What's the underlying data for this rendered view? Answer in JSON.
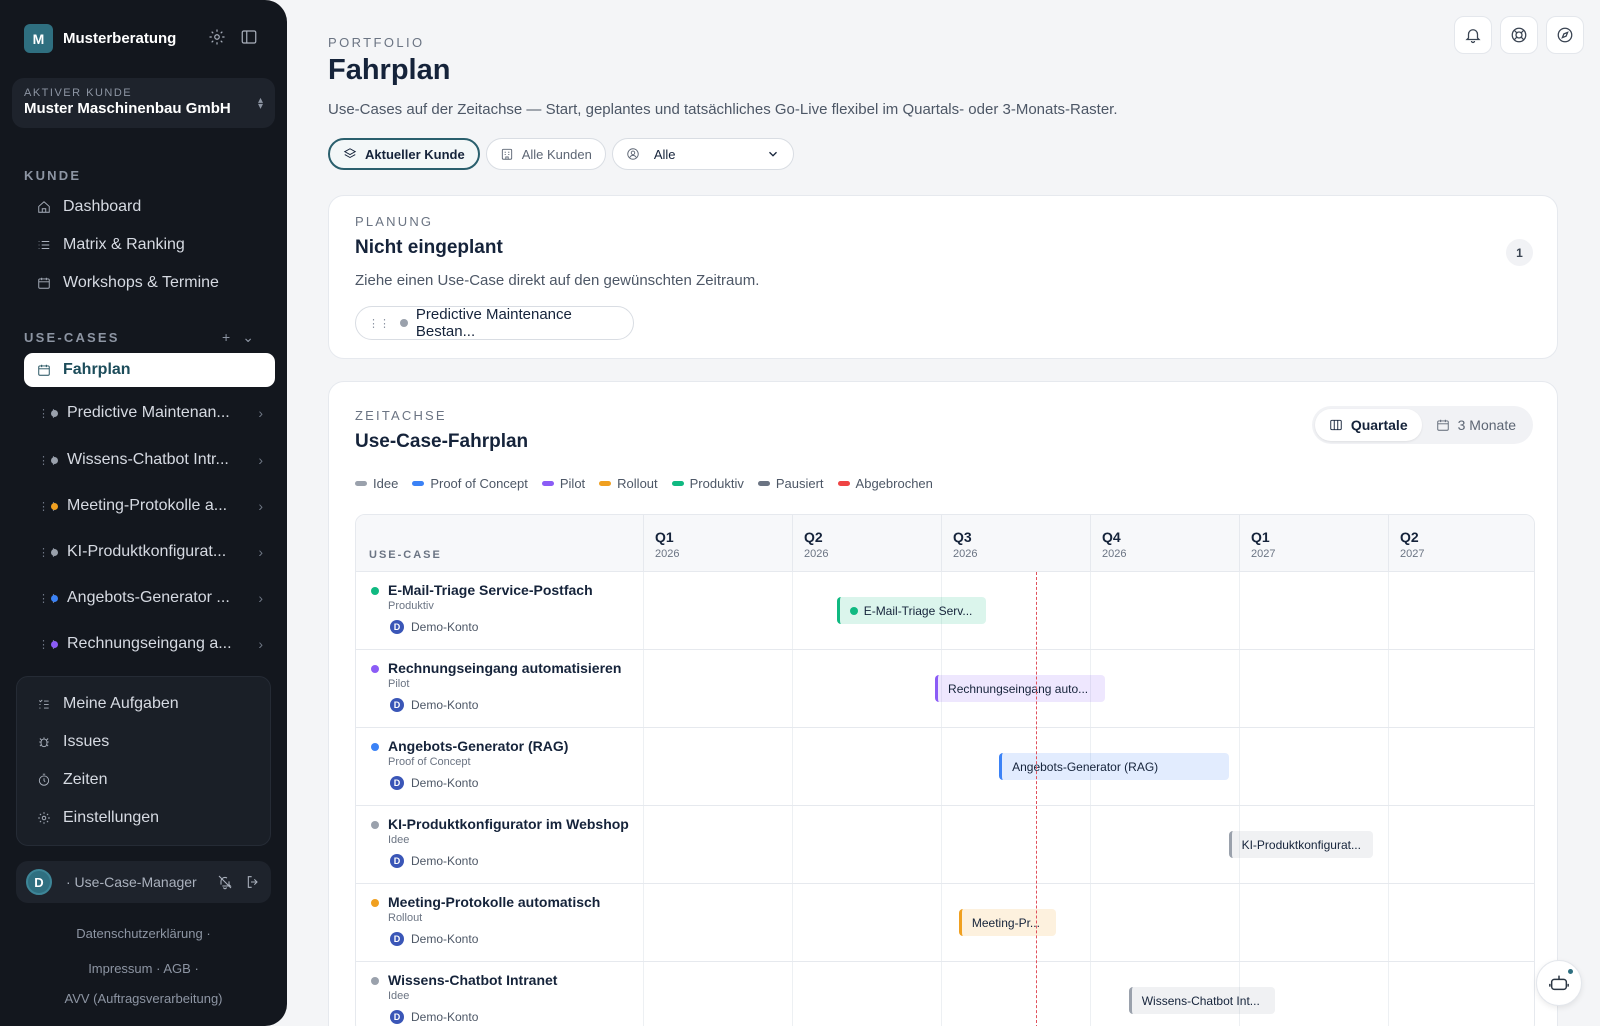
{
  "sidebar": {
    "brand_initial": "M",
    "brand_name": "Musterberatung",
    "client_label": "AKTIVER KUNDE",
    "client_name": "Muster Maschinenbau GmbH",
    "section_kunde": "KUNDE",
    "kunde_items": [
      {
        "label": "Dashboard",
        "icon": "home-icon"
      },
      {
        "label": "Matrix & Ranking",
        "icon": "list-icon"
      },
      {
        "label": "Workshops & Termine",
        "icon": "calendar-icon"
      }
    ],
    "section_usecases": "USE-CASES",
    "active_item": "Fahrplan",
    "usecase_items": [
      {
        "label": "Predictive Maintenan...",
        "color": "#9aa1ac"
      },
      {
        "label": "Wissens-Chatbot Intr...",
        "color": "#9aa1ac"
      },
      {
        "label": "Meeting-Protokolle a...",
        "color": "#f0a020"
      },
      {
        "label": "KI-Produktkonfigurat...",
        "color": "#9aa1ac"
      },
      {
        "label": "Angebots-Generator ...",
        "color": "#3b82f6"
      },
      {
        "label": "Rechnungseingang a...",
        "color": "#8b5cf6"
      }
    ],
    "tools": [
      {
        "label": "Meine Aufgaben",
        "icon": "tasks-icon"
      },
      {
        "label": "Issues",
        "icon": "bug-icon"
      },
      {
        "label": "Zeiten",
        "icon": "timer-icon"
      },
      {
        "label": "Einstellungen",
        "icon": "gear-icon"
      }
    ],
    "user_initial": "D",
    "user_role": "· Use-Case-Manager",
    "footer": {
      "privacy": "Datenschutzerklärung",
      "imprint": "Impressum",
      "terms": "AGB",
      "avv": "AVV (Auftragsverarbeitung)",
      "sep": "·"
    }
  },
  "header": {
    "eyebrow": "PORTFOLIO",
    "title": "Fahrplan",
    "subtitle": "Use-Cases auf der Zeitachse — Start, geplantes und tatsächliches Go-Live flexibel im Quartals- oder 3-Monats-Raster.",
    "filter_current": "Aktueller Kunde",
    "filter_all": "Alle Kunden",
    "owner_select": "Alle"
  },
  "planning": {
    "eyebrow": "PLANUNG",
    "title": "Nicht eingeplant",
    "count": "1",
    "hint": "Ziehe einen Use-Case direkt auf den gewünschten Zeitraum.",
    "chip_label": "Predictive Maintenance Bestan...",
    "chip_color": "#9aa1ac"
  },
  "timeline": {
    "eyebrow": "ZEITACHSE",
    "title": "Use-Case-Fahrplan",
    "toggle_quarters": "Quartale",
    "toggle_months": "3 Monate",
    "legend": [
      {
        "label": "Idee",
        "color": "#9aa1ac"
      },
      {
        "label": "Proof of Concept",
        "color": "#3b82f6"
      },
      {
        "label": "Pilot",
        "color": "#8b5cf6"
      },
      {
        "label": "Rollout",
        "color": "#f0a020"
      },
      {
        "label": "Produktiv",
        "color": "#10b981"
      },
      {
        "label": "Pausiert",
        "color": "#6b7483"
      },
      {
        "label": "Abgebrochen",
        "color": "#ef4444"
      }
    ],
    "column_header": "USE-CASE",
    "quarters": [
      {
        "name": "Q1",
        "year": "2026"
      },
      {
        "name": "Q2",
        "year": "2026"
      },
      {
        "name": "Q3",
        "year": "2026"
      },
      {
        "name": "Q4",
        "year": "2026"
      },
      {
        "name": "Q1",
        "year": "2027"
      },
      {
        "name": "Q2",
        "year": "2027"
      }
    ],
    "today_quarter_pos": 2.64,
    "rows": [
      {
        "title": "E-Mail-Triage Service-Postfach",
        "status": "Produktiv",
        "owner": "Demo-Konto",
        "owner_initial": "D",
        "color": "#10b981",
        "bar_label": "E-Mail-Triage Serv...",
        "start_q": 1.3,
        "end_q": 2.3,
        "bar_dot": true
      },
      {
        "title": "Rechnungseingang automatisieren",
        "status": "Pilot",
        "owner": "Demo-Konto",
        "owner_initial": "D",
        "color": "#8b5cf6",
        "bar_label": "Rechnungseingang auto...",
        "start_q": 1.96,
        "end_q": 3.1,
        "bar_dot": false
      },
      {
        "title": "Angebots-Generator (RAG)",
        "status": "Proof of Concept",
        "owner": "Demo-Konto",
        "owner_initial": "D",
        "color": "#3b82f6",
        "bar_label": "Angebots-Generator (RAG)",
        "start_q": 2.39,
        "end_q": 3.93,
        "bar_dot": false
      },
      {
        "title": "KI-Produktkonfigurator im Webshop",
        "status": "Idee",
        "owner": "Demo-Konto",
        "owner_initial": "D",
        "color": "#9aa1ac",
        "bar_label": "KI-Produktkonfigurat...",
        "start_q": 3.93,
        "end_q": 4.9,
        "bar_dot": false
      },
      {
        "title": "Meeting-Protokolle automatisch",
        "status": "Rollout",
        "owner": "Demo-Konto",
        "owner_initial": "D",
        "color": "#f0a020",
        "bar_label": "Meeting-Pr...",
        "start_q": 2.12,
        "end_q": 2.77,
        "bar_dot": false
      },
      {
        "title": "Wissens-Chatbot Intranet",
        "status": "Idee",
        "owner": "Demo-Konto",
        "owner_initial": "D",
        "color": "#9aa1ac",
        "bar_label": "Wissens-Chatbot Int...",
        "start_q": 3.26,
        "end_q": 4.24,
        "bar_dot": false
      }
    ]
  }
}
